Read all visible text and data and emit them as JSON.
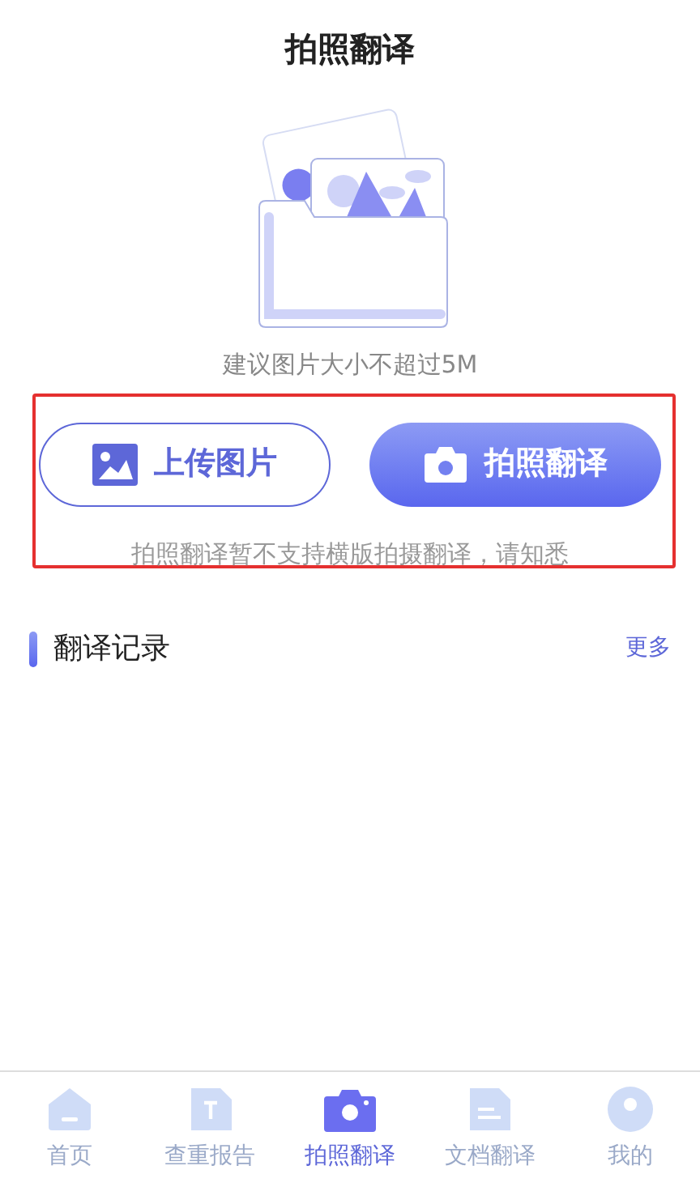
{
  "title": "拍照翻译",
  "hint": "建议图片大小不超过5M",
  "buttons": [
    {
      "kind": "outline",
      "label": "上传图片"
    },
    {
      "kind": "filled",
      "label": "拍照翻译"
    }
  ],
  "note": "拍照翻译暂不支持横版拍摄翻译，请知悉",
  "history": {
    "title": "翻译记录",
    "more": "更多"
  },
  "tabs": [
    {
      "kind": "home",
      "label": "首页",
      "selected": false
    },
    {
      "kind": "report",
      "label": "查重报告",
      "selected": false
    },
    {
      "kind": "camera",
      "label": "拍照翻译",
      "selected": true
    },
    {
      "kind": "document",
      "label": "文档翻译",
      "selected": false
    },
    {
      "kind": "profile",
      "label": "我的",
      "selected": false
    }
  ]
}
